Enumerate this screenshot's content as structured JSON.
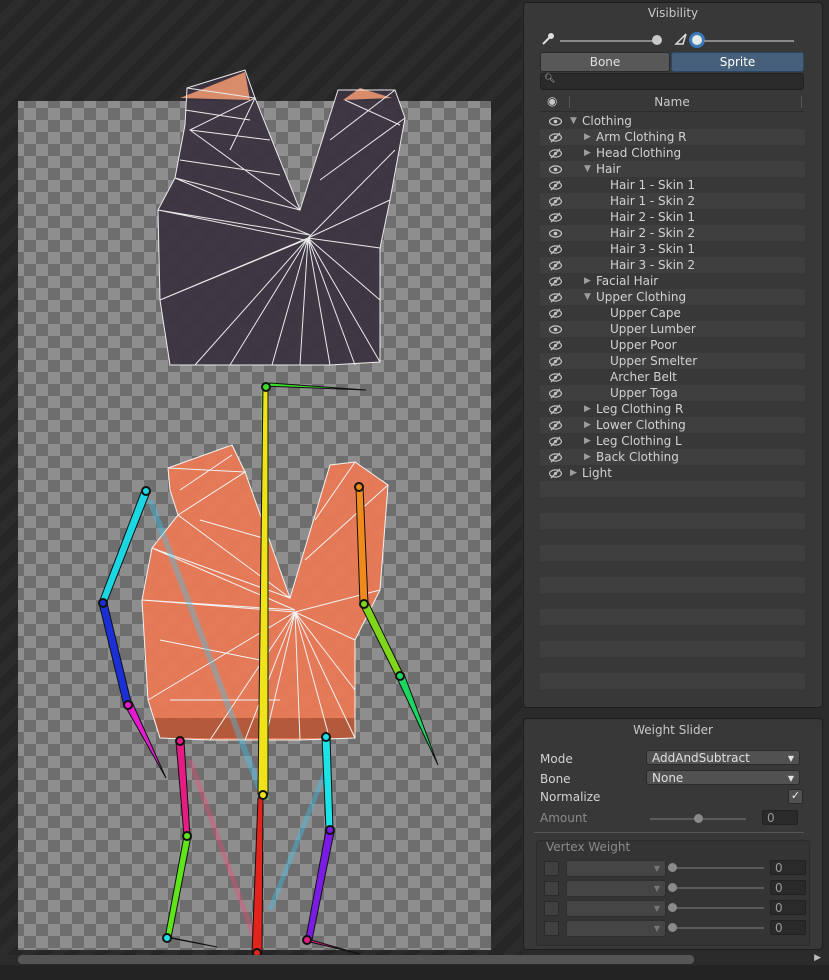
{
  "visibility": {
    "title": "Visibility",
    "toggles": [
      {
        "label": "Bone",
        "active": false
      },
      {
        "label": "Sprite",
        "active": true
      }
    ],
    "search_placeholder": "",
    "column_name": "Name",
    "tree": [
      {
        "label": "Clothing",
        "depth": 0,
        "arrow": "expanded",
        "visible": true
      },
      {
        "label": "Arm Clothing R",
        "depth": 1,
        "arrow": "collapsed",
        "visible": false
      },
      {
        "label": "Head Clothing",
        "depth": 1,
        "arrow": "collapsed",
        "visible": false
      },
      {
        "label": "Hair",
        "depth": 1,
        "arrow": "expanded",
        "visible": true
      },
      {
        "label": "Hair 1 - Skin 1",
        "depth": 2,
        "arrow": "none",
        "visible": false
      },
      {
        "label": "Hair 1 - Skin 2",
        "depth": 2,
        "arrow": "none",
        "visible": false
      },
      {
        "label": "Hair 2 - Skin 1",
        "depth": 2,
        "arrow": "none",
        "visible": false
      },
      {
        "label": "Hair 2 - Skin 2",
        "depth": 2,
        "arrow": "none",
        "visible": true
      },
      {
        "label": "Hair 3 - Skin 1",
        "depth": 2,
        "arrow": "none",
        "visible": false
      },
      {
        "label": "Hair 3 - Skin 2",
        "depth": 2,
        "arrow": "none",
        "visible": false
      },
      {
        "label": "Facial Hair",
        "depth": 1,
        "arrow": "collapsed",
        "visible": false
      },
      {
        "label": "Upper Clothing",
        "depth": 1,
        "arrow": "expanded",
        "visible": false
      },
      {
        "label": "Upper Cape",
        "depth": 2,
        "arrow": "none",
        "visible": false
      },
      {
        "label": "Upper Lumber",
        "depth": 2,
        "arrow": "none",
        "visible": true
      },
      {
        "label": "Upper Poor",
        "depth": 2,
        "arrow": "none",
        "visible": false
      },
      {
        "label": "Upper Smelter",
        "depth": 2,
        "arrow": "none",
        "visible": false
      },
      {
        "label": "Archer Belt",
        "depth": 2,
        "arrow": "none",
        "visible": false
      },
      {
        "label": "Upper Toga",
        "depth": 2,
        "arrow": "none",
        "visible": false
      },
      {
        "label": "Leg Clothing R",
        "depth": 1,
        "arrow": "collapsed",
        "visible": false
      },
      {
        "label": "Lower Clothing",
        "depth": 1,
        "arrow": "collapsed",
        "visible": false
      },
      {
        "label": "Leg Clothing L",
        "depth": 1,
        "arrow": "collapsed",
        "visible": false
      },
      {
        "label": "Back Clothing",
        "depth": 1,
        "arrow": "collapsed",
        "visible": false
      },
      {
        "label": "Light",
        "depth": 0,
        "arrow": "collapsed",
        "visible": false
      }
    ]
  },
  "weight_slider": {
    "title": "Weight Slider",
    "mode_label": "Mode",
    "mode_value": "AddAndSubtract",
    "bone_label": "Bone",
    "bone_value": "None",
    "normalize_label": "Normalize",
    "normalize_checked": true,
    "amount_label": "Amount",
    "amount_value": "0",
    "vertex_weight_label": "Vertex Weight",
    "vertex_values": [
      "0",
      "0",
      "0",
      "0"
    ]
  },
  "icons": {
    "eye_visible": "eye-icon",
    "eye_hidden": "eye-slash-icon",
    "search": "search-icon",
    "bone_opacity": "bone-brush-icon",
    "mesh_opacity": "mesh-triangle-icon"
  }
}
